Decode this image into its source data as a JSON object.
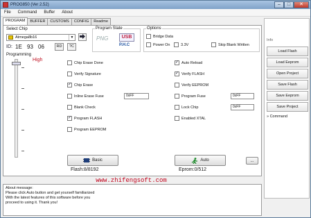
{
  "window": {
    "title": "PROG850 (Ver 2.52)"
  },
  "menu": [
    "File",
    "Command",
    "Buffer",
    "About"
  ],
  "tabs": [
    "PROGRAM",
    "BUFFER",
    "CUSTOMS",
    "CONFIG",
    "Readme"
  ],
  "select_chip": {
    "label": "Select Chip",
    "value": "Atmega8b16",
    "id_label": "ID:",
    "id_bytes": [
      "1E",
      "93",
      "06"
    ],
    "id_buttons": [
      "RD",
      "?C"
    ]
  },
  "program_state": {
    "label": "Program State",
    "state_text": "PNG",
    "usb_text": "USB",
    "prog_text": "P.H.C"
  },
  "options": {
    "label": "Options",
    "items": [
      "Bridge Data",
      "Power On",
      "3.3V"
    ],
    "skip_blank": "Skip Blank Written"
  },
  "programming": {
    "label": "Programming",
    "level": "High"
  },
  "checks_left": [
    {
      "label": "Chip Erase Done",
      "checked": false
    },
    {
      "label": "Verify Signature",
      "checked": false
    },
    {
      "label": "Chip Erase",
      "checked": true
    },
    {
      "label": "Inline Erase Fuse",
      "checked": false,
      "value": "0xFF"
    },
    {
      "label": "Blank Check",
      "checked": false
    },
    {
      "label": "Program FLASH",
      "checked": true
    },
    {
      "label": "Program EEPROM",
      "checked": false
    }
  ],
  "checks_right": [
    {
      "label": "Auto Reload",
      "checked": true
    },
    {
      "label": "Verify FLASH",
      "checked": true
    },
    {
      "label": "Verify EEPROM",
      "checked": false
    },
    {
      "label": "Program Fuse",
      "checked": false,
      "value": "0xFF"
    },
    {
      "label": "Lock Chip",
      "checked": false,
      "value": "0xFF"
    },
    {
      "label": "Enabled XTAL",
      "checked": false
    }
  ],
  "buttons": {
    "basic": "Basic",
    "auto": "Auto",
    "more": "..."
  },
  "status": {
    "flash": "Flash:8/8192",
    "eeprom": "Eprom:0/512"
  },
  "website": "www.zhifengsoft.com",
  "messages": [
    "About message:",
    "Please click Auto button and get yourself familiarized",
    "With the latest features of this software before you",
    "proceed to using it. Thank you!"
  ],
  "side_panel": {
    "header": "Info",
    "buttons": [
      "Load Flash",
      "Load Eeprom",
      "Open Project",
      "Save Flash",
      "Save Eeprom",
      "Save Project"
    ],
    "command": "» Command"
  },
  "colors": {
    "website": "#c0001a",
    "title_bar": "#8fb0d4",
    "close": "#c0392b"
  }
}
